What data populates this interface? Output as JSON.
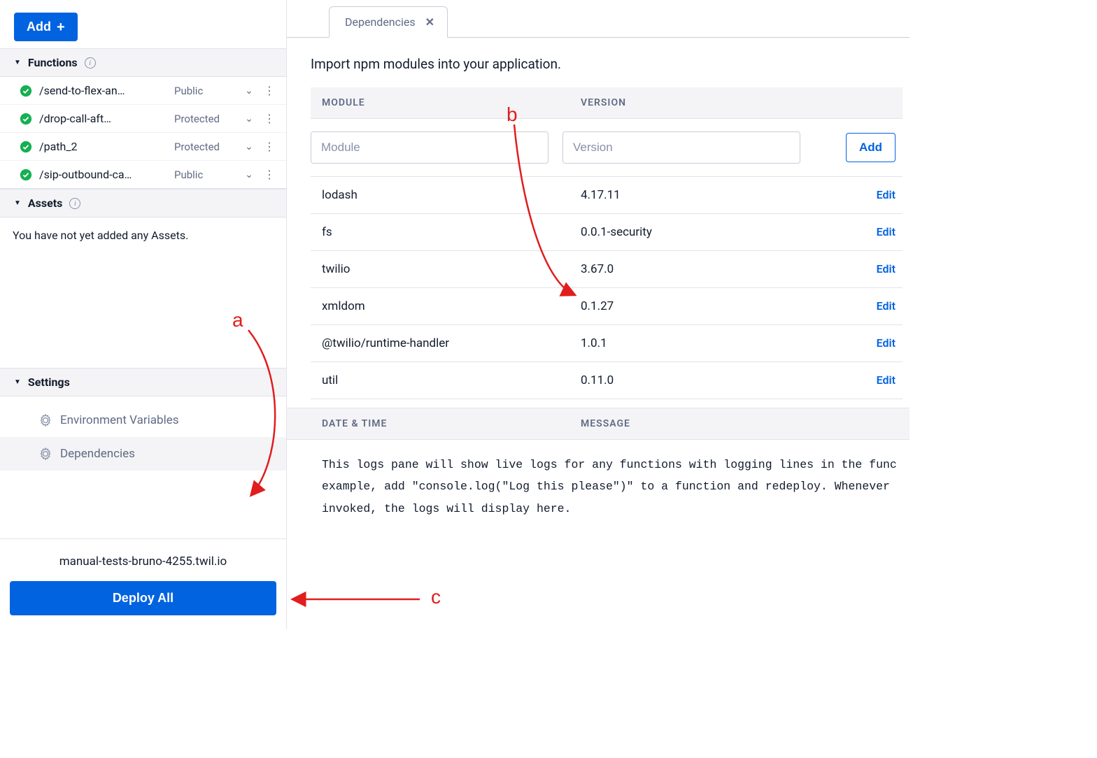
{
  "sidebar": {
    "add_button": "Add",
    "functions_header": "Functions",
    "functions": [
      {
        "name": "/send-to-flex-an…",
        "access": "Public"
      },
      {
        "name": "/drop-call-aft…",
        "access": "Protected"
      },
      {
        "name": "/path_2",
        "access": "Protected"
      },
      {
        "name": "/sip-outbound-ca…",
        "access": "Public"
      }
    ],
    "assets_header": "Assets",
    "assets_empty": "You have not yet added any Assets.",
    "settings_header": "Settings",
    "settings": {
      "env": "Environment Variables",
      "deps": "Dependencies"
    },
    "domain": "manual-tests-bruno-4255.twil.io",
    "deploy_button": "Deploy All"
  },
  "main": {
    "tab_label": "Dependencies",
    "intro": "Import npm modules into your application.",
    "col_module": "MODULE",
    "col_version": "VERSION",
    "module_placeholder": "Module",
    "version_placeholder": "Version",
    "add_btn": "Add",
    "edit_label": "Edit",
    "rows": [
      {
        "module": "lodash",
        "version": "4.17.11"
      },
      {
        "module": "fs",
        "version": "0.0.1-security"
      },
      {
        "module": "twilio",
        "version": "3.67.0"
      },
      {
        "module": "xmldom",
        "version": "0.1.27"
      },
      {
        "module": "@twilio/runtime-handler",
        "version": "1.0.1"
      },
      {
        "module": "util",
        "version": "0.11.0"
      }
    ],
    "logs_col1": "DATE & TIME",
    "logs_col2": "MESSAGE",
    "logs_body": "This logs pane will show live logs for any functions with logging lines in the func\nexample, add \"console.log(\"Log this please\")\" to a function and redeploy. Whenever \ninvoked, the logs will display here."
  },
  "annotations": {
    "a": "a",
    "b": "b",
    "c": "c"
  }
}
